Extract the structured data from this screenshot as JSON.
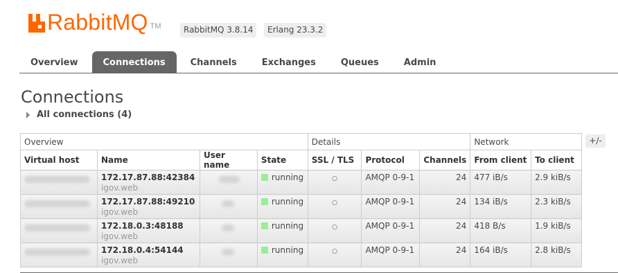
{
  "header": {
    "logo_text": "RabbitMQ",
    "logo_tm": "TM",
    "version_badge": "RabbitMQ 3.8.14",
    "erlang_badge": "Erlang 23.3.2",
    "accent_color": "#ff6600"
  },
  "tabs": [
    {
      "label": "Overview",
      "active": false
    },
    {
      "label": "Connections",
      "active": true
    },
    {
      "label": "Channels",
      "active": false
    },
    {
      "label": "Exchanges",
      "active": false
    },
    {
      "label": "Queues",
      "active": false
    },
    {
      "label": "Admin",
      "active": false
    }
  ],
  "page_title": "Connections",
  "section_label": "All connections (4)",
  "plus_minus": "+/-",
  "table": {
    "groups": [
      "Overview",
      "Details",
      "Network"
    ],
    "columns": [
      "Virtual host",
      "Name",
      "User name",
      "State",
      "SSL / TLS",
      "Protocol",
      "Channels",
      "From client",
      "To client"
    ],
    "rows": [
      {
        "name": "172.17.87.88:42384",
        "client": "igov.web",
        "state": "running",
        "ssl": "○",
        "protocol": "AMQP 0-9-1",
        "channels": "24",
        "from_client": "477 iB/s",
        "to_client": "2.9 kiB/s"
      },
      {
        "name": "172.17.87.88:49210",
        "client": "igov.web",
        "state": "running",
        "ssl": "○",
        "protocol": "AMQP 0-9-1",
        "channels": "24",
        "from_client": "134 iB/s",
        "to_client": "2.3 kiB/s"
      },
      {
        "name": "172.18.0.3:48188",
        "client": "igov.web",
        "state": "running",
        "ssl": "○",
        "protocol": "AMQP 0-9-1",
        "channels": "24",
        "from_client": "418 B/s",
        "to_client": "1.9 kiB/s"
      },
      {
        "name": "172.18.0.4:54144",
        "client": "igov.web",
        "state": "running",
        "ssl": "○",
        "protocol": "AMQP 0-9-1",
        "channels": "24",
        "from_client": "164 iB/s",
        "to_client": "2.8 kiB/s"
      }
    ]
  },
  "colors": {
    "running_state": "#99ee99",
    "active_tab": "#666666"
  }
}
